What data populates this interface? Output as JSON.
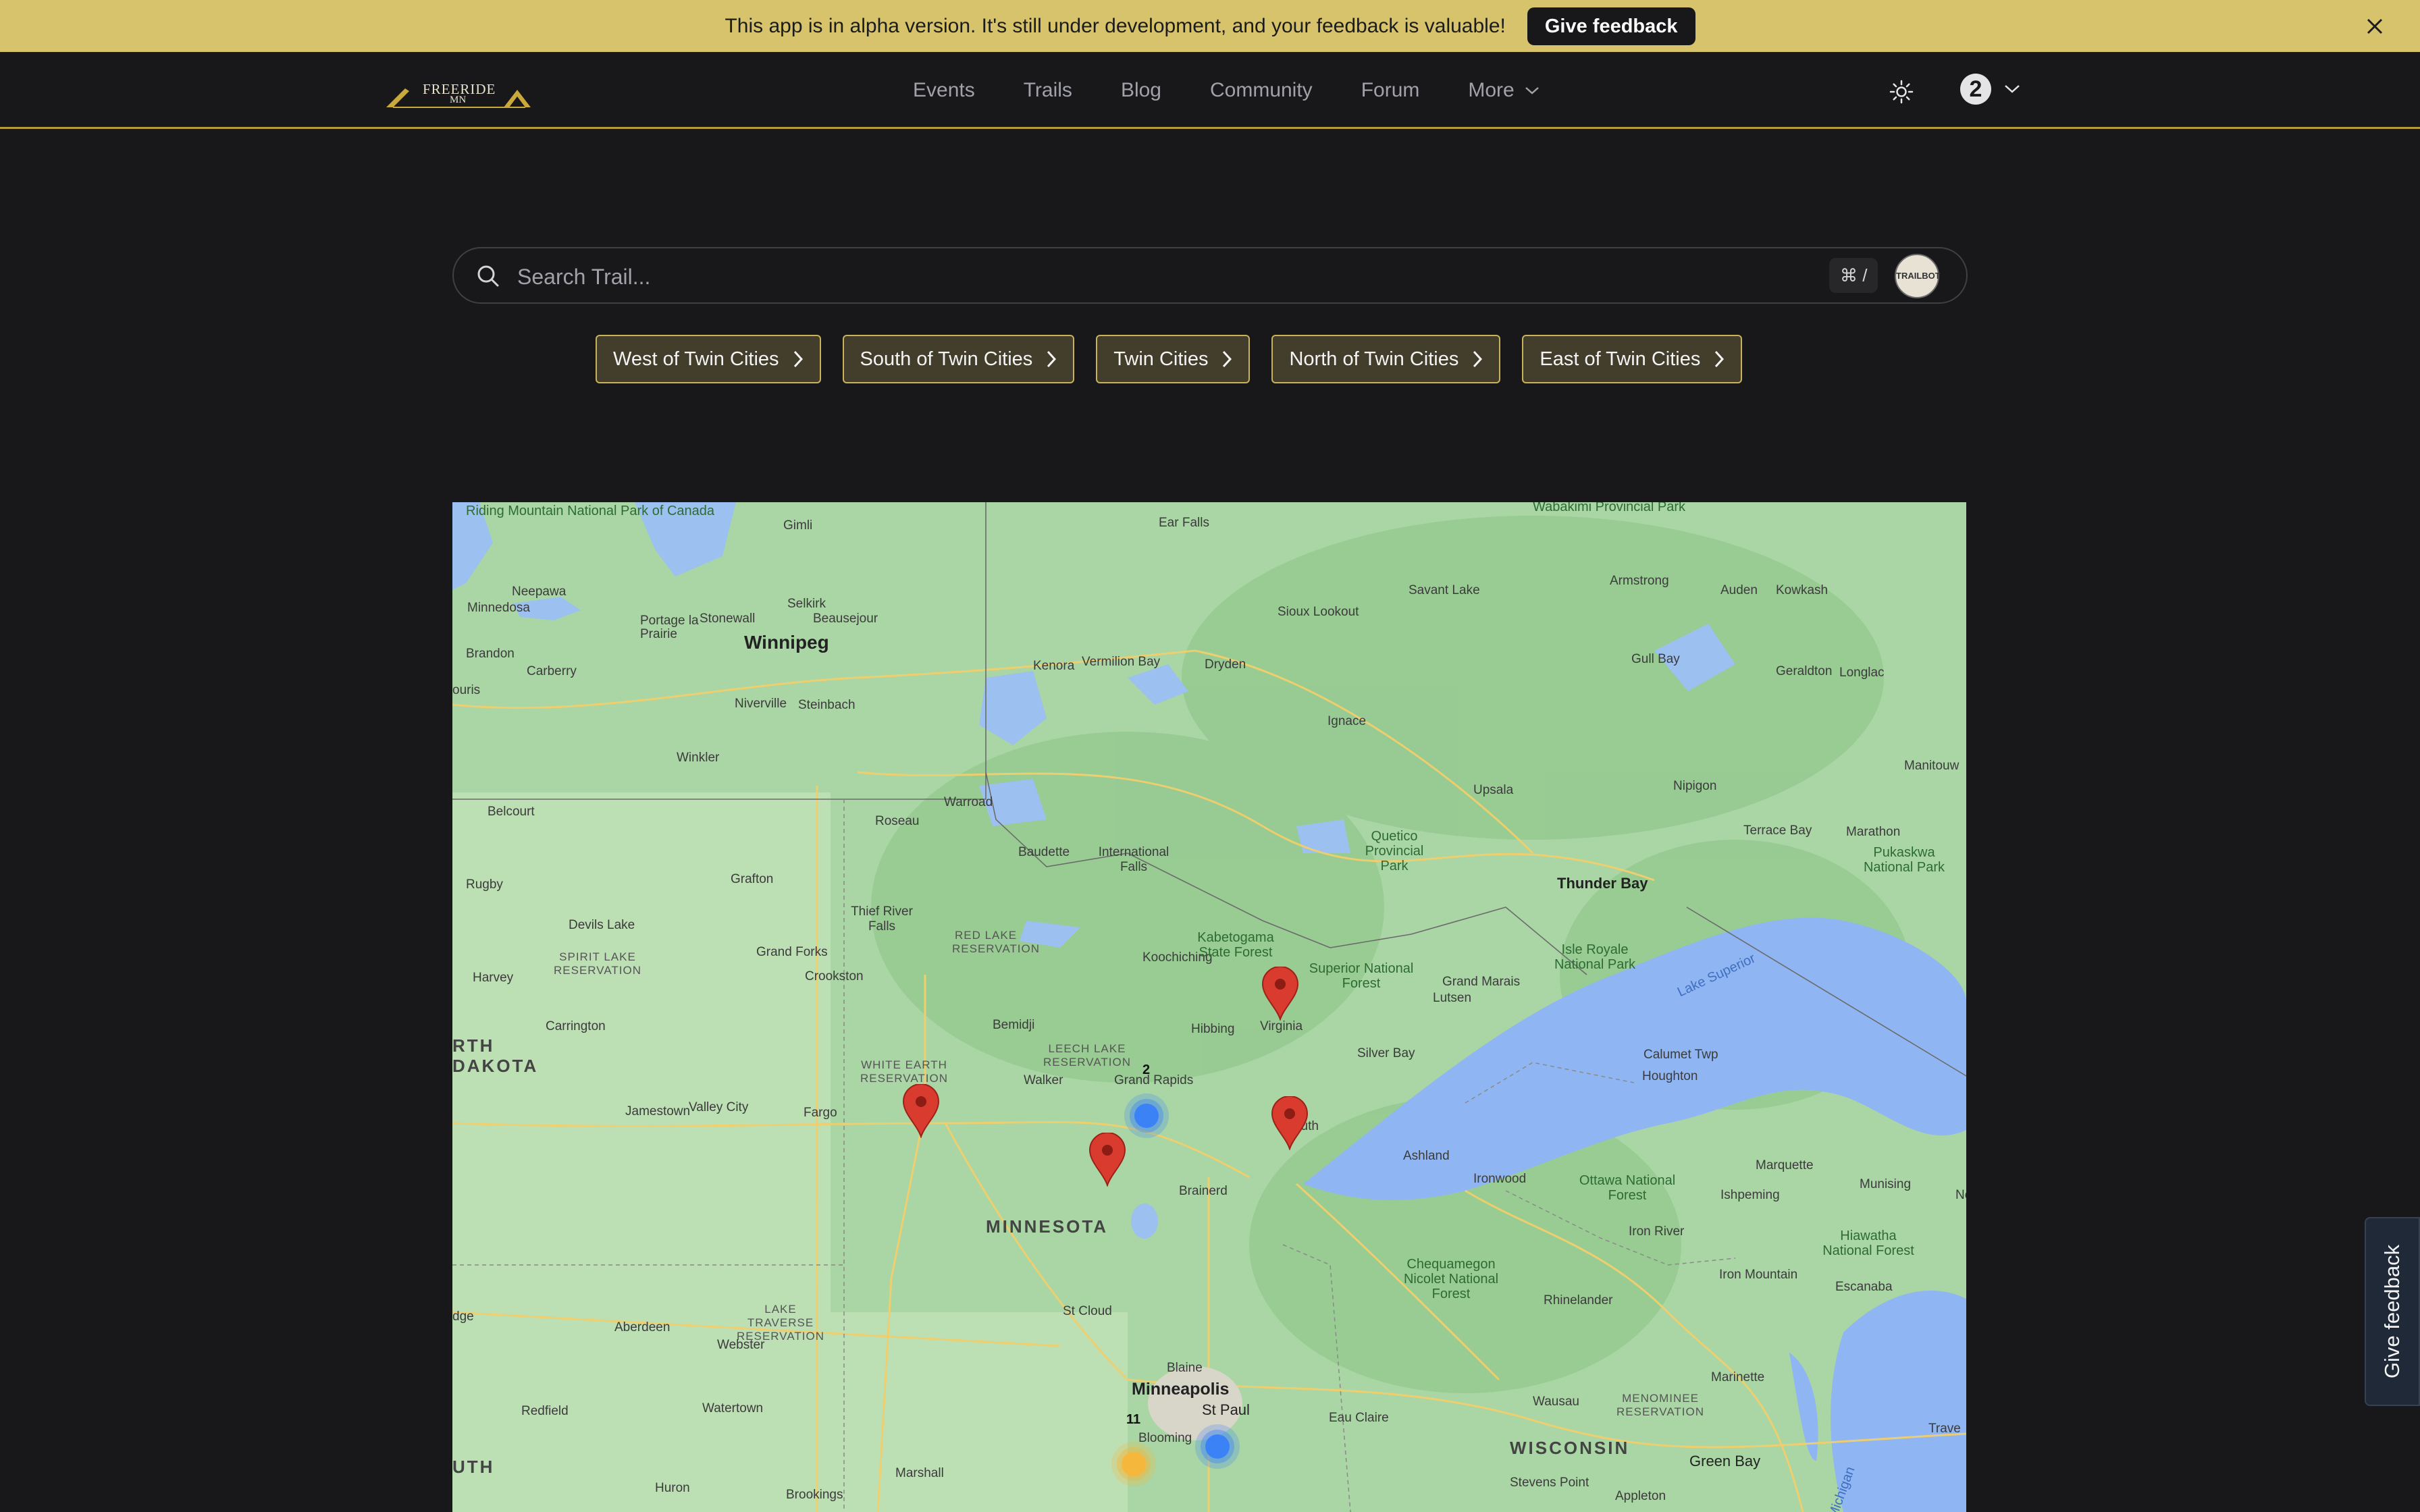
{
  "banner": {
    "text": "This app is in alpha version. It's still under development, and your feedback is valuable!",
    "button_label": "Give feedback",
    "close_icon": "close-icon"
  },
  "header": {
    "logo_text": "FREERIDE",
    "logo_subtext": "MN",
    "nav": [
      "Events",
      "Trails",
      "Blog",
      "Community",
      "Forum",
      "More"
    ],
    "theme_icon": "sun-icon",
    "notification_count": "2"
  },
  "search": {
    "placeholder": "Search Trail...",
    "shortcut": "⌘ /",
    "bot_label": "TRAILBOT"
  },
  "regions": [
    "West of Twin Cities",
    "South of Twin Cities",
    "Twin Cities",
    "North of Twin Cities",
    "East of Twin Cities"
  ],
  "map": {
    "labels": {
      "riding_mountain": "Riding Mountain National Park of Canada",
      "gimli": "Gimli",
      "ear_falls": "Ear Falls",
      "wabakimi": "Wabakimi Provincial Park",
      "neepawa": "Neepawa",
      "selkirk": "Selkirk",
      "beausejour": "Beausejour",
      "savant_lake": "Savant Lake",
      "armstrong": "Armstrong",
      "auden": "Auden",
      "kowkash": "Kowkash",
      "minnedosa": "Minnedosa",
      "portage": "Portage la Prairie",
      "stonewall": "Stonewall",
      "sioux_lookout": "Sioux Lookout",
      "winnipeg": "Winnipeg",
      "brandon": "Brandon",
      "carberry": "Carberry",
      "kenora": "Kenora",
      "vermilion_bay": "Vermilion Bay",
      "dryden": "Dryden",
      "gull_bay": "Gull Bay",
      "geraldton": "Geraldton",
      "longlac": "Longlac",
      "niverville": "Niverville",
      "steinbach": "Steinbach",
      "ignace": "Ignace",
      "winkler": "Winkler",
      "manitouwadge": "Manitouw",
      "belcourt": "Belcourt",
      "warroad": "Warroad",
      "upsala": "Upsala",
      "nipigon": "Nipigon",
      "terrace_bay": "Terrace Bay",
      "marathon": "Marathon",
      "roseau": "Roseau",
      "baudette": "Baudette",
      "intl_falls": "International Falls",
      "quetico": "Quetico Provincial Park",
      "pukaskwa": "Pukaskwa National Park",
      "rugby": "Rugby",
      "grafton": "Grafton",
      "thunder_bay": "Thunder Bay",
      "devils_lake": "Devils Lake",
      "thief_river": "Thief River Falls",
      "koochiching": "Koochiching",
      "kabetogama": "Kabetogama State Forest",
      "spirit_lake": "SPIRIT LAKE RESERVATION",
      "red_lake": "RED LAKE RESERVATION",
      "isle_royale": "Isle Royale National Park",
      "harvey": "Harvey",
      "grand_forks": "Grand Forks",
      "crookston": "Crookston",
      "superior_nf": "Superior National Forest",
      "grand_marais": "Grand Marais",
      "lutsen": "Lutsen",
      "lake_superior": "Lake Superior",
      "carrington": "Carrington",
      "bemidji": "Bemidji",
      "hibbing": "Hibbing",
      "virginia": "Virginia",
      "silver_bay": "Silver Bay",
      "calumet": "Calumet Twp",
      "north_dakota": "RTH DAKOTA",
      "white_earth": "WHITE EARTH RESERVATION",
      "leech_lake": "LEECH LAKE RESERVATION",
      "houghton": "Houghton",
      "walker": "Walker",
      "grand_rapids": "Grand Rapids",
      "jamestown": "Jamestown",
      "valley_city": "Valley City",
      "fargo": "Fargo",
      "duluth": "Duluth",
      "ashland": "Ashland",
      "marquette": "Marquette",
      "munising": "Munising",
      "ishpeming": "Ishpeming",
      "brainerd": "Brainerd",
      "ironwood": "Ironwood",
      "ottawa_nf": "Ottawa National Forest",
      "minnesota": "MINNESOTA",
      "iron_river": "Iron River",
      "hiawatha": "Hiawatha National Forest",
      "chequamegon": "Chequamegon Nicolet National Forest",
      "iron_mountain": "Iron Mountain",
      "escanaba": "Escanaba",
      "lake_traverse": "LAKE TRAVERSE RESERVATION",
      "rhinelander": "Rhinelander",
      "st_cloud": "St Cloud",
      "aberdeen": "Aberdeen",
      "webster": "Webster",
      "blaine": "Blaine",
      "minneapolis": "Minneapolis",
      "st_paul": "St Paul",
      "bloomington": "Blooming",
      "redfield": "Redfield",
      "watertown": "Watertown",
      "eau_claire": "Eau Claire",
      "wausau": "Wausau",
      "menominee": "MENOMINEE RESERVATION",
      "marinette": "Marinette",
      "wisconsin": "WISCONSIN",
      "green_bay": "Green Bay",
      "south_dakota": "UTH",
      "huron": "Huron",
      "marshall": "Marshall",
      "brookings": "Brookings",
      "stevens_point": "Stevens Point",
      "appleton": "Appleton",
      "lake_michigan": "Michigan",
      "traverse": "Trave",
      "edge_ouris": "ouris",
      "edge_dge": "dge",
      "edge_ne": "Ne"
    },
    "clusters": [
      {
        "count": "2",
        "color": "#3b82f6"
      },
      {
        "count": "",
        "color": "#3b82f6"
      },
      {
        "count": "11",
        "color": "#f5b83d"
      }
    ],
    "markers_count": 4
  },
  "side_feedback": "Give feedback"
}
